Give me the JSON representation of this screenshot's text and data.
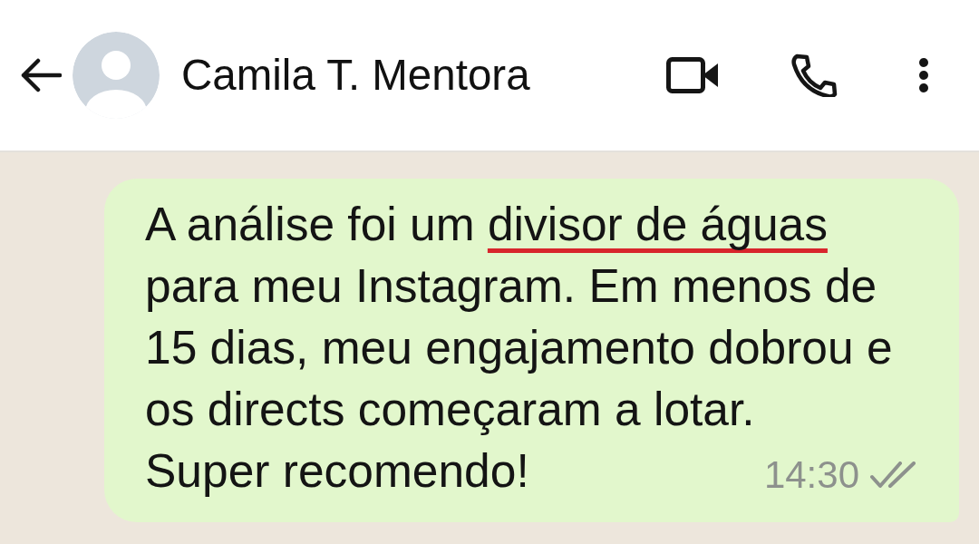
{
  "header": {
    "contact_name": "Camila T. Mentora"
  },
  "messages": [
    {
      "text_before_underline": "A análise foi um ",
      "underlined_text": "divisor de águas",
      "text_after_underline": " para meu Instagram. Em menos de 15 dias, meu engajamento dobrou e os directs começaram a lotar.",
      "closing_text": "Super recomendo!",
      "time": "14:30",
      "read": false
    }
  ]
}
